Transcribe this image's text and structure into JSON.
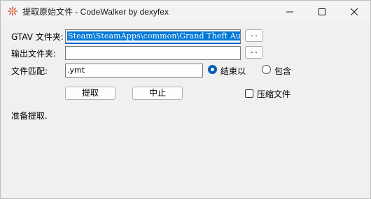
{
  "window": {
    "title": "提取原始文件 - CodeWalker by dexyfex",
    "icon": "codewalker-app-icon"
  },
  "form": {
    "gtav_folder_label": "GTAV 文件夹:",
    "gtav_folder_value": "Steam\\SteamApps\\common\\Grand Theft Auto V",
    "gtav_browse_label": "..",
    "output_folder_label": "输出文件夹:",
    "output_folder_value": "",
    "output_browse_label": "..",
    "file_match_label": "文件匹配:",
    "file_match_value": ".ymt",
    "match_mode": {
      "ends_with_label": "结束以",
      "contains_label": "包含",
      "selected": "ends_with"
    }
  },
  "actions": {
    "extract_label": "提取",
    "abort_label": "中止",
    "compressed_label": "压缩文件",
    "compressed_checked": false
  },
  "status": {
    "text": "准备提取."
  },
  "colors": {
    "selection": "#0078d7",
    "radio_accent": "#005fb8",
    "focus_underline": "#0a64c8"
  }
}
